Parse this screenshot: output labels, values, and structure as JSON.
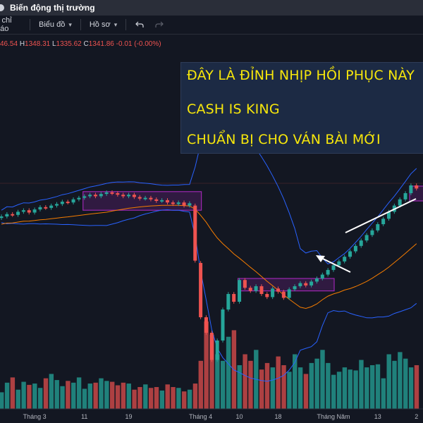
{
  "window": {
    "title": "Biến động thị trường"
  },
  "toolbar": {
    "indicators_label": "c chỉ báo",
    "chart_type_label": "Biểu đồ",
    "profile_label": "Hồ sơ"
  },
  "ohlc": {
    "open_partial": "46.54",
    "h_key": "H",
    "h_val": "1348.31",
    "l_key": "L",
    "l_val": "1335.62",
    "c_key": "C",
    "c_val": "1341.86",
    "change": "-0.01 (-0.00%)"
  },
  "annotation": {
    "line1": "ĐÂY LÀ ĐỈNH NHỊP HỒI PHỤC NÀY",
    "line2": "CASH IS KING",
    "line3": "CHUẨN BỊ CHO VÁN BÀI MỚI"
  },
  "colors": {
    "up": "#26a69a",
    "down": "#ef5350",
    "bb": "#2962ff",
    "ma": "#f57c00",
    "box_border": "#9c27b0",
    "box_fill": "rgba(156,39,176,0.22)",
    "anno_text": "#f7e70b"
  },
  "chart_data": {
    "type": "candlestick",
    "x_ticks": [
      "Tháng 3",
      "11",
      "19",
      "Tháng 4",
      "10",
      "18",
      "Tháng Năm",
      "13",
      "2"
    ],
    "price": {
      "open": [
        1208,
        1210,
        1213,
        1212,
        1216,
        1218,
        1215,
        1219,
        1222,
        1221,
        1224,
        1226,
        1229,
        1228,
        1232,
        1234,
        1236,
        1238,
        1236,
        1239,
        1241,
        1240,
        1238,
        1236,
        1238,
        1235,
        1233,
        1234,
        1232,
        1230,
        1231,
        1228,
        1226,
        1228,
        1224,
        1224,
        1150,
        1080,
        1060,
        1025,
        1050,
        1090,
        1110,
        1100,
        1128,
        1118,
        1114,
        1120,
        1110,
        1106,
        1117,
        1113,
        1105,
        1116,
        1120,
        1124,
        1121,
        1126,
        1130,
        1135,
        1141,
        1147,
        1152,
        1158,
        1165,
        1172,
        1179,
        1186,
        1192,
        1200,
        1207,
        1216,
        1224,
        1232,
        1240,
        1250
      ],
      "close": [
        1210,
        1213,
        1212,
        1216,
        1218,
        1215,
        1219,
        1222,
        1221,
        1224,
        1226,
        1229,
        1228,
        1232,
        1234,
        1236,
        1238,
        1236,
        1239,
        1241,
        1240,
        1238,
        1236,
        1238,
        1235,
        1233,
        1234,
        1232,
        1230,
        1231,
        1228,
        1226,
        1228,
        1224,
        1227,
        1153,
        1080,
        1060,
        1025,
        1050,
        1090,
        1110,
        1100,
        1128,
        1118,
        1114,
        1120,
        1110,
        1106,
        1117,
        1113,
        1105,
        1116,
        1120,
        1124,
        1121,
        1126,
        1130,
        1135,
        1141,
        1147,
        1152,
        1158,
        1165,
        1172,
        1179,
        1186,
        1192,
        1200,
        1207,
        1216,
        1224,
        1232,
        1240,
        1250,
        1246
      ],
      "volume": [
        38,
        60,
        72,
        44,
        62,
        55,
        58,
        48,
        70,
        80,
        66,
        52,
        64,
        60,
        72,
        46,
        58,
        60,
        70,
        64,
        62,
        54,
        60,
        58,
        44,
        50,
        56,
        48,
        50,
        42,
        56,
        50,
        48,
        40,
        44,
        58,
        110,
        200,
        170,
        125,
        110,
        165,
        180,
        100,
        125,
        110,
        135,
        90,
        105,
        95,
        120,
        100,
        85,
        125,
        95,
        80,
        105,
        115,
        135,
        105,
        78,
        85,
        95,
        90,
        88,
        112,
        95,
        100,
        102,
        70,
        125,
        110,
        130,
        115,
        95,
        100
      ]
    },
    "highlight_boxes": [
      {
        "x_start": "11",
        "x_end": "Tháng 4",
        "price_low": 1218,
        "price_high": 1242
      },
      {
        "x_start": "10",
        "x_end": "Tháng Năm",
        "price_low": 1114,
        "price_high": 1130
      }
    ]
  }
}
